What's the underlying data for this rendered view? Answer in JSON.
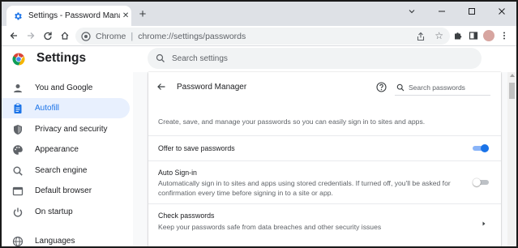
{
  "tab": {
    "title": "Settings - Password Manager",
    "close_glyph": "✕"
  },
  "newtab_glyph": "+",
  "omnibox": {
    "chip": "Chrome",
    "separator": "|",
    "url": "chrome://settings/passwords",
    "star_glyph": "☆"
  },
  "header": {
    "title": "Settings",
    "search_placeholder": "Search settings"
  },
  "sidebar": {
    "items": [
      {
        "label": "You and Google",
        "icon": "person-icon"
      },
      {
        "label": "Autofill",
        "icon": "clipboard-icon",
        "active": true
      },
      {
        "label": "Privacy and security",
        "icon": "shield-icon"
      },
      {
        "label": "Appearance",
        "icon": "palette-icon"
      },
      {
        "label": "Search engine",
        "icon": "search-icon"
      },
      {
        "label": "Default browser",
        "icon": "browser-icon"
      },
      {
        "label": "On startup",
        "icon": "power-icon"
      },
      {
        "label": "Languages",
        "icon": "globe-icon"
      }
    ]
  },
  "password_manager": {
    "title": "Password Manager",
    "search_placeholder": "Search passwords",
    "description": "Create, save, and manage your passwords so you can easily sign in to sites and apps.",
    "offer_to_save": {
      "label": "Offer to save passwords",
      "enabled": true
    },
    "auto_signin": {
      "label": "Auto Sign-in",
      "description_line1": "Automatically sign in to sites and apps using stored credentials. If turned off, you'll be asked for",
      "description_line2": "confirmation every time before signing in to a site or app.",
      "enabled": false
    },
    "check_passwords": {
      "label": "Check passwords",
      "description": "Keep your passwords safe from data breaches and other security issues"
    }
  },
  "colors": {
    "accent": "#1a73e8",
    "active_bg": "#e8f0fe",
    "tabstrip_bg": "#dee1e6"
  }
}
